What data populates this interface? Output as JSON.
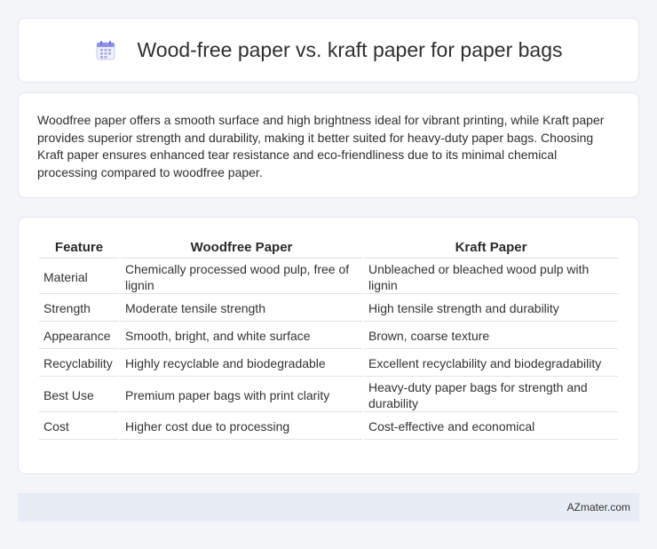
{
  "header": {
    "icon": "calendar-icon",
    "title": "Wood-free paper vs. kraft paper for paper bags"
  },
  "summary": {
    "text": "Woodfree paper offers a smooth surface and high brightness ideal for vibrant printing, while Kraft paper provides superior strength and durability, making it better suited for heavy-duty paper bags. Choosing Kraft paper ensures enhanced tear resistance and eco-friendliness due to its minimal chemical processing compared to woodfree paper."
  },
  "table": {
    "headers": [
      "Feature",
      "Woodfree Paper",
      "Kraft Paper"
    ],
    "rows": [
      [
        "Material",
        "Chemically processed wood pulp, free of lignin",
        "Unbleached or bleached wood pulp with lignin"
      ],
      [
        "Strength",
        "Moderate tensile strength",
        "High tensile strength and durability"
      ],
      [
        "Appearance",
        "Smooth, bright, and white surface",
        "Brown, coarse texture"
      ],
      [
        "Recyclability",
        "Highly recyclable and biodegradable",
        "Excellent recyclability and biodegradability"
      ],
      [
        "Best Use",
        "Premium paper bags with print clarity",
        "Heavy-duty paper bags for strength and durability"
      ],
      [
        "Cost",
        "Higher cost due to processing",
        "Cost-effective and economical"
      ]
    ]
  },
  "footer": {
    "brand": "AZmater.com"
  }
}
